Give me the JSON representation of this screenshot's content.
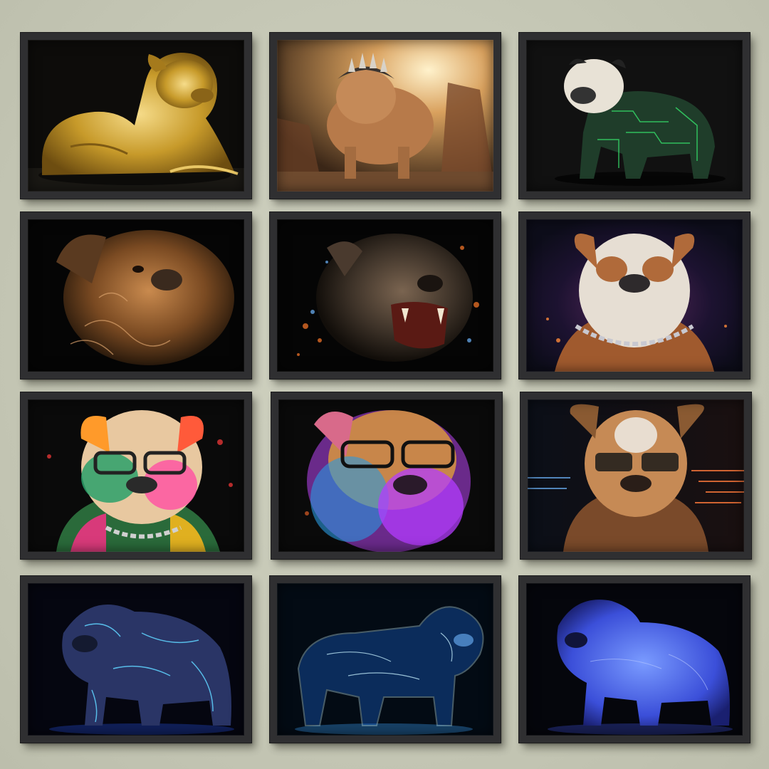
{
  "gallery": {
    "background_color": "#c7c9b7",
    "frame_color": "#2f2f31",
    "artworks": [
      {
        "subject": "bulldog",
        "style": "gold sculpture",
        "palette": [
          "#0b0b0b",
          "#c9a227",
          "#f5d77a"
        ]
      },
      {
        "subject": "bulldog",
        "style": "spiked armor desert",
        "palette": [
          "#4a3220",
          "#c98a4e",
          "#f2d3a0"
        ]
      },
      {
        "subject": "bulldog",
        "style": "green circuit board",
        "palette": [
          "#111111",
          "#1f4d2e",
          "#35e06a"
        ]
      },
      {
        "subject": "bulldog",
        "style": "bronze ornamental head",
        "palette": [
          "#050505",
          "#7a4a22",
          "#c9874a"
        ]
      },
      {
        "subject": "bulldog",
        "style": "snarling splash portrait",
        "palette": [
          "#050505",
          "#5a4632",
          "#6fb7ff"
        ]
      },
      {
        "subject": "bulldog",
        "style": "chain collar nebula",
        "palette": [
          "#0d0d1a",
          "#e0d8cf",
          "#b04a8a"
        ]
      },
      {
        "subject": "bulldog",
        "style": "rainbow glasses chain",
        "palette": [
          "#0a0a0a",
          "#ff4fa3",
          "#ffb020"
        ]
      },
      {
        "subject": "bulldog",
        "style": "neon glasses portrait",
        "palette": [
          "#0a0a0a",
          "#b43cff",
          "#ffa64d"
        ]
      },
      {
        "subject": "bulldog",
        "style": "sunglasses light streaks",
        "palette": [
          "#0b0f18",
          "#c68a55",
          "#ff7a3a"
        ]
      },
      {
        "subject": "bulldog",
        "style": "dark blue neon lines",
        "palette": [
          "#050610",
          "#2a3566",
          "#5fd4ff"
        ]
      },
      {
        "subject": "bulldog",
        "style": "cyan hologram",
        "palette": [
          "#030b14",
          "#3fa7ff",
          "#c8f2ff"
        ]
      },
      {
        "subject": "bulldog",
        "style": "blue glow",
        "palette": [
          "#05060c",
          "#3b4fd9",
          "#7a9bff"
        ]
      }
    ]
  }
}
